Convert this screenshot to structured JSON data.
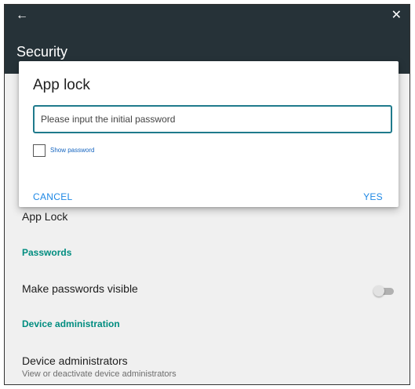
{
  "appbar": {
    "back_icon": "arrow-left-icon",
    "close_icon": "close-icon",
    "title": "Security"
  },
  "settings": {
    "app_lock_label": "App Lock",
    "passwords_header": "Passwords",
    "make_passwords_visible_label": "Make passwords visible",
    "make_passwords_visible_on": false,
    "device_admin_header": "Device administration",
    "device_administrators_label": "Device administrators",
    "device_administrators_summary": "View or deactivate device administrators"
  },
  "dialog": {
    "title": "App lock",
    "password_value": "",
    "password_placeholder": "Please input the initial password",
    "show_password_label": "Show password",
    "show_password_checked": false,
    "cancel_label": "CANCEL",
    "yes_label": "YES"
  },
  "colors": {
    "appbar": "#263238",
    "accent": "#009688",
    "button": "#1e88e5"
  }
}
